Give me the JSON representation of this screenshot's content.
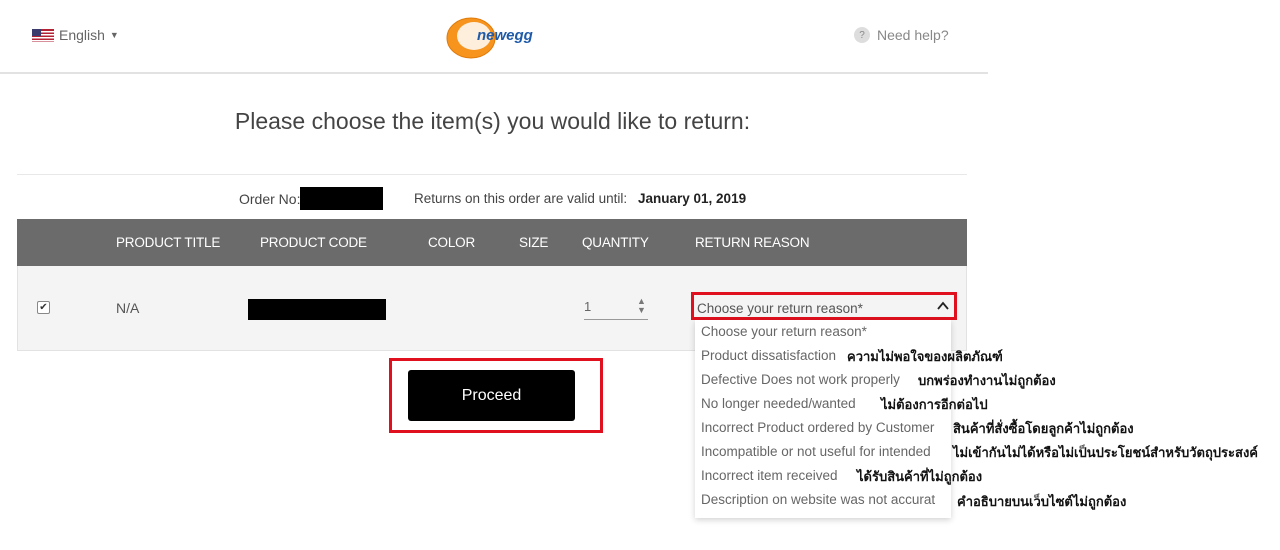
{
  "header": {
    "language": "English",
    "logo_text": "newegg",
    "help": "Need help?",
    "help_icon": "?"
  },
  "page_title": "Please choose the item(s) you would like to return:",
  "order": {
    "label": "Order No:",
    "valid_label": "Returns on this order are valid until:",
    "valid_date": "January 01, 2019"
  },
  "table": {
    "headers": [
      "PRODUCT TITLE",
      "PRODUCT CODE",
      "COLOR",
      "SIZE",
      "QUANTITY",
      "RETURN REASON"
    ],
    "row": {
      "checked": true,
      "title": "N/A",
      "quantity": "1",
      "return_reason": "Choose your return reason*"
    }
  },
  "return_reasons": [
    {
      "label": "Choose your return reason*",
      "thai": ""
    },
    {
      "label": "Product dissatisfaction",
      "thai": "ความไม่พอใจของผลิตภัณฑ์"
    },
    {
      "label": "Defective Does not work properly",
      "thai": "บกพร่องทำงานไม่ถูกต้อง"
    },
    {
      "label": "No longer needed/wanted",
      "thai": "ไม่ต้องการอีกต่อไป"
    },
    {
      "label": "Incorrect Product ordered by Customer",
      "thai": "สินค้าที่สั่งซื้อโดยลูกค้าไม่ถูกต้อง"
    },
    {
      "label": "Incompatible or not useful for intended",
      "thai": "ไม่เข้ากันไม่ได้หรือไม่เป็นประโยชน์สำหรับวัตถุประสงค์"
    },
    {
      "label": "Incorrect item received",
      "thai": "ได้รับสินค้าที่ไม่ถูกต้อง"
    },
    {
      "label": "Description on website was not accurat",
      "thai": "คำอธิบายบนเว็บไซต์ไม่ถูกต้อง"
    }
  ],
  "proceed_label": "Proceed",
  "colors": {
    "header_bar": "#6b6b6b",
    "highlight_red": "#e0101e",
    "button_bg": "#000000",
    "logo_orange": "#f7941d",
    "logo_blue": "#1e5aa8"
  }
}
